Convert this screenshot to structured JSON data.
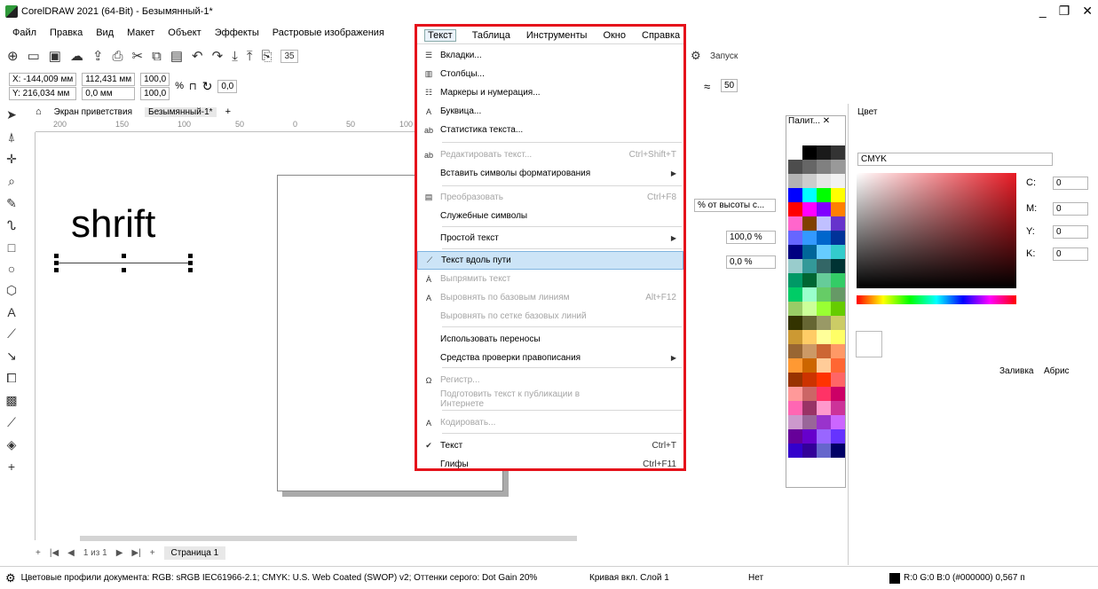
{
  "window": {
    "title": "CorelDRAW 2021 (64-Bit) - Безымянный-1*"
  },
  "menubar": [
    "Файл",
    "Правка",
    "Вид",
    "Макет",
    "Объект",
    "Эффекты",
    "Растровые изображения"
  ],
  "menu_header": [
    "Текст",
    "Таблица",
    "Инструменты",
    "Окно",
    "Справка"
  ],
  "toolbar": {
    "zoom": "35",
    "launch": "Запуск"
  },
  "propbar": {
    "x": "X: -144,009 мм",
    "y": "Y: 216,034 мм",
    "w": "112,431 мм",
    "h": "0,0 мм",
    "sx": "100,0",
    "sy": "100,0",
    "pct": "%",
    "angle": "0,0",
    "smooth": "50"
  },
  "tabs": {
    "welcome": "Экран приветствия",
    "doc": "Безымянный-1*"
  },
  "ruler": [
    "200",
    "150",
    "100",
    "50",
    "0",
    "50",
    "100"
  ],
  "canvas": {
    "text": "shrift"
  },
  "pagebar": {
    "pages": "1 из 1",
    "page_tab": "Страница 1"
  },
  "status": {
    "profile": "Цветовые профили документа: RGB: sRGB IEC61966-2.1; CMYK: U.S. Web Coated (SWOP) v2; Оттенки серого: Dot Gain 20%",
    "layer": "Кривая вкл. Слой 1",
    "none": "Нет",
    "color": "R:0 G:0 B:0 (#000000) 0,567 п"
  },
  "right": {
    "pct_height": "% от высоты с...",
    "v1": "100,0 %",
    "v2": "0,0 %"
  },
  "palette": {
    "title": "Палит..."
  },
  "colorpanel": {
    "title": "Цвет",
    "model": "CMYK",
    "c": "C:",
    "m": "M:",
    "y": "Y:",
    "k": "K:",
    "cv": "0",
    "mv": "0",
    "yv": "0",
    "kv": "0",
    "fill": "Заливка",
    "outline": "Абрис"
  },
  "menu": [
    {
      "label": "Вкладки...",
      "sc": "",
      "dis": false
    },
    {
      "label": "Столбцы...",
      "sc": "",
      "dis": false
    },
    {
      "label": "Маркеры и нумерация...",
      "sc": "",
      "dis": false
    },
    {
      "label": "Буквица...",
      "sc": "",
      "dis": false
    },
    {
      "label": "Статистика текста...",
      "sc": "",
      "dis": false
    },
    {
      "label": "Редактировать текст...",
      "sc": "Ctrl+Shift+T",
      "dis": true
    },
    {
      "label": "Вставить символы форматирования",
      "sc": "",
      "dis": false
    },
    {
      "label": "Преобразовать",
      "sc": "Ctrl+F8",
      "dis": true
    },
    {
      "label": "Служебные символы",
      "sc": "",
      "dis": false
    },
    {
      "label": "Простой текст",
      "sc": "",
      "dis": false
    },
    {
      "label": "Текст вдоль пути",
      "sc": "",
      "dis": false
    },
    {
      "label": "Выпрямить текст",
      "sc": "",
      "dis": true
    },
    {
      "label": "Выровнять по базовым линиям",
      "sc": "Alt+F12",
      "dis": true
    },
    {
      "label": "Выровнять по сетке базовых линий",
      "sc": "",
      "dis": true
    },
    {
      "label": "Использовать переносы",
      "sc": "",
      "dis": false
    },
    {
      "label": "Средства проверки правописания",
      "sc": "",
      "dis": false
    },
    {
      "label": "Регистр...",
      "sc": "",
      "dis": true
    },
    {
      "label": "Подготовить текст к публикации в Интернете",
      "sc": "",
      "dis": true
    },
    {
      "label": "Кодировать...",
      "sc": "",
      "dis": true
    },
    {
      "label": "Текст",
      "sc": "Ctrl+T",
      "dis": false
    },
    {
      "label": "Глифы",
      "sc": "Ctrl+F11",
      "dis": false
    }
  ],
  "palette_colors": [
    "#ffffff",
    "#000000",
    "#1a1a1a",
    "#333333",
    "#4d4d4d",
    "#666666",
    "#808080",
    "#999999",
    "#b3b3b3",
    "#cccccc",
    "#e6e6e6",
    "#f2f2f2",
    "#0000ff",
    "#00ffff",
    "#00ff00",
    "#ffff00",
    "#ff0000",
    "#ff00ff",
    "#8000ff",
    "#ff8000",
    "#ff66cc",
    "#804000",
    "#c0c0ff",
    "#6633cc",
    "#6666ff",
    "#3399ff",
    "#0066cc",
    "#003399",
    "#000080",
    "#006699",
    "#66ccff",
    "#33cccc",
    "#99cccc",
    "#339999",
    "#336666",
    "#003333",
    "#009966",
    "#006633",
    "#66cc99",
    "#33cc66",
    "#00cc66",
    "#99ffcc",
    "#66cc66",
    "#669966",
    "#99cc66",
    "#ccff99",
    "#99ff33",
    "#66cc00",
    "#333300",
    "#666633",
    "#999966",
    "#cccc66",
    "#cc9933",
    "#ffcc66",
    "#ffff99",
    "#ffff66",
    "#996633",
    "#cc9966",
    "#cc6633",
    "#ff9966",
    "#ff9933",
    "#cc6600",
    "#ffcc99",
    "#ff6633",
    "#993300",
    "#cc3300",
    "#ff3300",
    "#ff6666",
    "#ff9999",
    "#cc6666",
    "#ff3366",
    "#cc0066",
    "#ff66b3",
    "#993366",
    "#ff99cc",
    "#cc3399",
    "#cc99cc",
    "#996699",
    "#9933cc",
    "#cc66ff",
    "#660099",
    "#6600cc",
    "#9966ff",
    "#6633ff",
    "#3300cc",
    "#330099",
    "#6666cc",
    "#000066"
  ]
}
